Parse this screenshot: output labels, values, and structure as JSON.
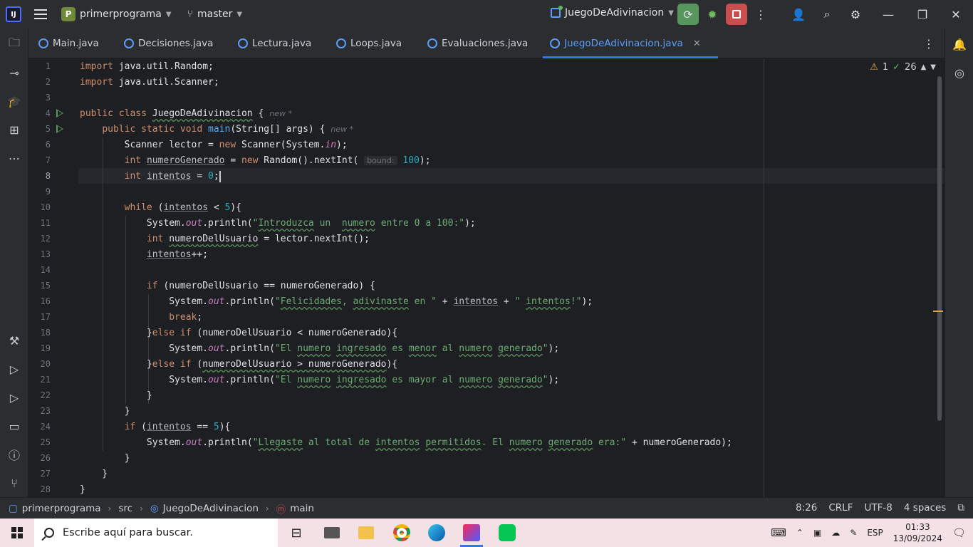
{
  "titlebar": {
    "project_badge": "P",
    "project_name": "primerprograma",
    "branch": "master",
    "run_config": "JuegoDeAdivinacion"
  },
  "tabs": [
    {
      "label": "Main.java"
    },
    {
      "label": "Decisiones.java"
    },
    {
      "label": "Lectura.java"
    },
    {
      "label": "Loops.java"
    },
    {
      "label": "Evaluaciones.java"
    },
    {
      "label": "JuegoDeAdivinacion.java",
      "active": true
    }
  ],
  "inspections": {
    "warnings": "1",
    "ok": "26"
  },
  "editor": {
    "line_numbers": [
      "1",
      "2",
      "3",
      "4",
      "5",
      "6",
      "7",
      "8",
      "9",
      "10",
      "11",
      "12",
      "13",
      "14",
      "15",
      "16",
      "17",
      "18",
      "19",
      "20",
      "21",
      "22",
      "23",
      "24",
      "25",
      "26",
      "27",
      "28"
    ],
    "current_line": 8,
    "hints": {
      "new_label": "new *",
      "bound_label": "bound:"
    }
  },
  "statusbar": {
    "breadcrumb": [
      "primerprograma",
      "src",
      "JuegoDeAdivinacion",
      "main"
    ],
    "position": "8:26",
    "line_sep": "CRLF",
    "encoding": "UTF-8",
    "indent": "4 spaces"
  },
  "taskbar": {
    "search_placeholder": "Escribe aquí para buscar.",
    "language": "ESP",
    "time": "01:33",
    "date": "13/09/2024"
  },
  "colors": {
    "accent": "#3574f0",
    "run": "#57965c",
    "stop": "#c94f4f"
  }
}
